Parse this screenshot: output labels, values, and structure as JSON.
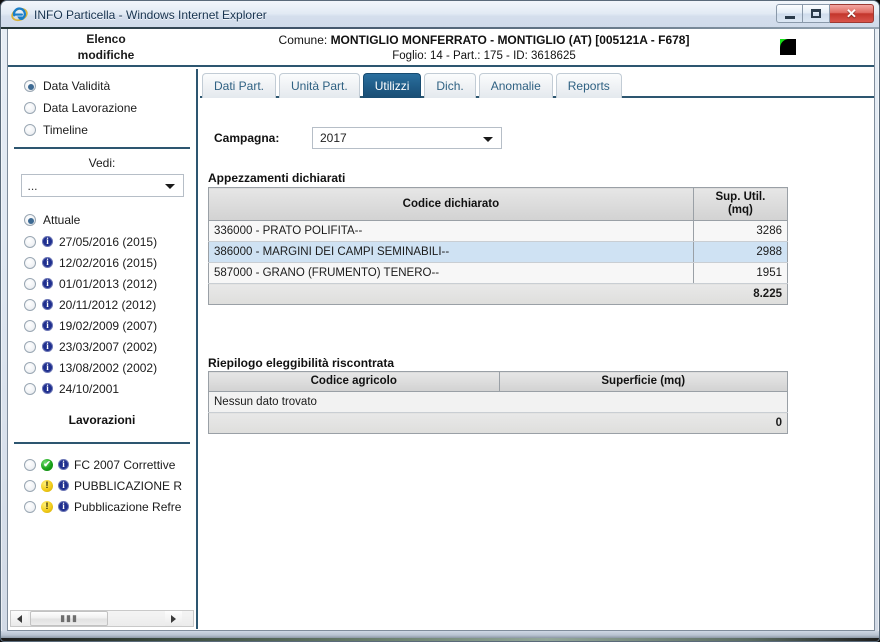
{
  "window": {
    "title": "INFO Particella - Windows Internet Explorer",
    "browser_icon": "internet-explorer-icon",
    "minimize_label": "",
    "maximize_label": "",
    "close_label": "✕"
  },
  "banner": {
    "left_line1": "Elenco",
    "left_line2": "modifiche",
    "comune_prefix": "Comune: ",
    "comune_value": "MONTIGLIO MONFERRATO - MONTIGLIO (AT) [005121A - F678]",
    "foglio_line": "Foglio: 14 - Part.: 175 - ID: 3618625",
    "logo_name": "app-logo",
    "accent_color": "#2d5670"
  },
  "sidebar": {
    "view_modes": [
      {
        "label": "Data Validità",
        "checked": true
      },
      {
        "label": "Data Lavorazione",
        "checked": false
      },
      {
        "label": "Timeline",
        "checked": false
      }
    ],
    "vedi_label": "Vedi:",
    "vedi_value": "...",
    "dates": [
      {
        "label": "Attuale",
        "checked": true,
        "info": false
      },
      {
        "label": "27/05/2016 (2015)",
        "checked": false,
        "info": true
      },
      {
        "label": "12/02/2016 (2015)",
        "checked": false,
        "info": true
      },
      {
        "label": "01/01/2013 (2012)",
        "checked": false,
        "info": true
      },
      {
        "label": "20/11/2012 (2012)",
        "checked": false,
        "info": true
      },
      {
        "label": "19/02/2009 (2007)",
        "checked": false,
        "info": true
      },
      {
        "label": "23/03/2007 (2002)",
        "checked": false,
        "info": true
      },
      {
        "label": "13/08/2002 (2002)",
        "checked": false,
        "info": true
      },
      {
        "label": "24/10/2001",
        "checked": false,
        "info": true
      }
    ],
    "lavorazioni_title": "Lavorazioni",
    "lavorazioni": [
      {
        "label": "FC 2007 Correttive",
        "status": "ok",
        "status_glyph": "✔",
        "checked": false
      },
      {
        "label": "PUBBLICAZIONE R",
        "status": "warn",
        "status_glyph": "!",
        "checked": false
      },
      {
        "label": "Pubblicazione Refre",
        "status": "warn",
        "status_glyph": "!",
        "checked": false
      }
    ],
    "scrollbar": {
      "grip": "▮▮▮",
      "left_arrow": "◀",
      "right_arrow": "▶"
    }
  },
  "main": {
    "tabs": [
      {
        "label": "Dati Part.",
        "active": false
      },
      {
        "label": "Unità Part.",
        "active": false
      },
      {
        "label": "Utilizzi",
        "active": true
      },
      {
        "label": "Dich.",
        "active": false
      },
      {
        "label": "Anomalie",
        "active": false
      },
      {
        "label": "Reports",
        "active": false
      }
    ],
    "campagna_label": "Campagna:",
    "campagna_value": "2017",
    "table1": {
      "title": "Appezzamenti dichiarati",
      "columns": [
        "Codice dichiarato",
        "Sup. Util. (mq)"
      ],
      "column2_line1": "Sup. Util.",
      "column2_line2": "(mq)",
      "rows": [
        {
          "codice": "336000 - PRATO POLIFITA--",
          "sup": "3286",
          "selected": false
        },
        {
          "codice": "386000 - MARGINI DEI CAMPI SEMINABILI--",
          "sup": "2988",
          "selected": true
        },
        {
          "codice": "587000 - GRANO (FRUMENTO) TENERO--",
          "sup": "1951",
          "selected": false
        }
      ],
      "total": "8.225"
    },
    "table2": {
      "title": "Riepilogo eleggibilità riscontrata",
      "columns": [
        "Codice agricolo",
        "Superficie (mq)"
      ],
      "empty_message": "Nessun dato trovato",
      "total": "0"
    }
  }
}
